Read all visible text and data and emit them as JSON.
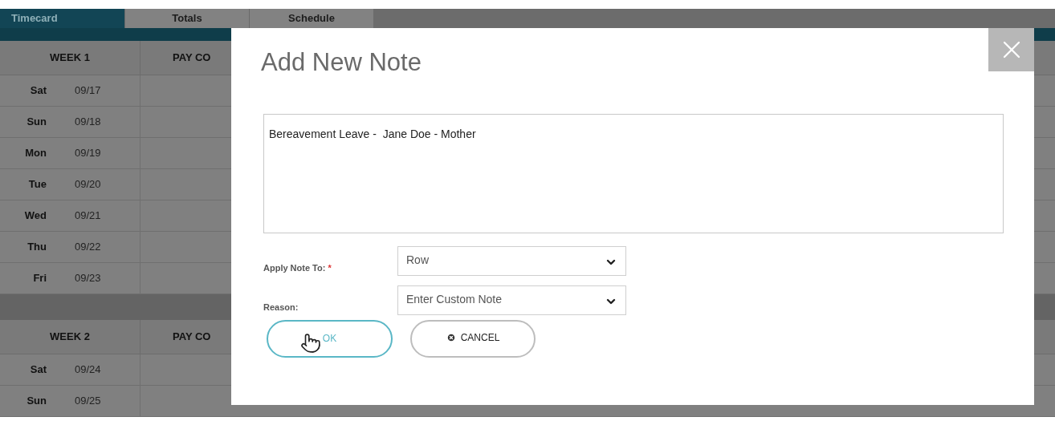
{
  "tabs": [
    {
      "label": "Timecard",
      "selected": true
    },
    {
      "label": "Totals",
      "selected": false
    },
    {
      "label": "Schedule",
      "selected": false
    }
  ],
  "weeks": [
    {
      "header": "WEEK 1",
      "column_2": "PAY CO",
      "rows": [
        {
          "day": "Sat",
          "date": "09/17"
        },
        {
          "day": "Sun",
          "date": "09/18"
        },
        {
          "day": "Mon",
          "date": "09/19"
        },
        {
          "day": "Tue",
          "date": "09/20"
        },
        {
          "day": "Wed",
          "date": "09/21"
        },
        {
          "day": "Thu",
          "date": "09/22"
        },
        {
          "day": "Fri",
          "date": "09/23"
        }
      ]
    },
    {
      "header": "WEEK 2",
      "column_2": "PAY CO",
      "rows": [
        {
          "day": "Sat",
          "date": "09/24"
        },
        {
          "day": "Sun",
          "date": "09/25"
        }
      ]
    }
  ],
  "modal": {
    "title": "Add New Note",
    "note_value": "Bereavement Leave -  Jane Doe - Mother",
    "fields": [
      {
        "label": "Apply Note To:",
        "required_mark": "*",
        "value": "Row"
      },
      {
        "label": "Reason:",
        "value": "Enter Custom Note"
      }
    ],
    "buttons": [
      {
        "label": "OK",
        "kind": "primary"
      },
      {
        "label": "CANCEL",
        "kind": "cancel"
      }
    ]
  }
}
